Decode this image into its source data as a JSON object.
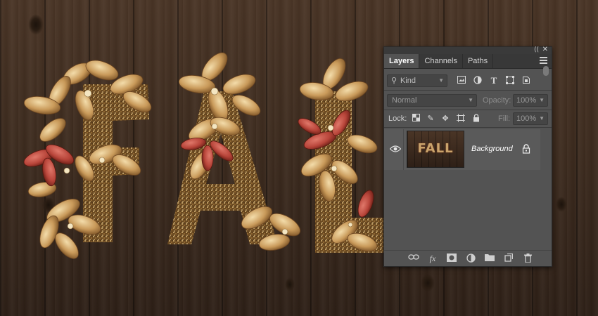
{
  "panel": {
    "tabs": [
      {
        "label": "Layers",
        "active": true
      },
      {
        "label": "Channels",
        "active": false
      },
      {
        "label": "Paths",
        "active": false
      }
    ],
    "collapse_icon": "double-chevron-icon",
    "close_icon": "close-icon",
    "menu_icon": "hamburger-menu-icon",
    "filter": {
      "kind_label": "Kind",
      "icons": [
        "search-icon",
        "pixel-layer-filter-icon",
        "adjustment-layer-filter-icon",
        "type-layer-filter-icon",
        "shape-layer-filter-icon",
        "smart-object-filter-icon"
      ]
    },
    "blend": {
      "mode": "Normal",
      "opacity_label": "Opacity:",
      "opacity_value": "100%"
    },
    "lock": {
      "label": "Lock:",
      "icons": [
        "lock-transparent-pixels-icon",
        "lock-image-pixels-icon",
        "lock-position-icon",
        "lock-artboard-icon",
        "lock-all-icon"
      ],
      "fill_label": "Fill:",
      "fill_value": "100%"
    },
    "layers": [
      {
        "name": "Background",
        "thumb_text": "FALL",
        "visible": true,
        "locked": true
      }
    ],
    "footer_icons": [
      "link-layers-icon",
      "layer-style-fx-icon",
      "add-mask-icon",
      "adjustment-layer-icon",
      "new-group-icon",
      "new-layer-icon",
      "delete-icon"
    ],
    "footer_fx": "fx"
  },
  "colors": {
    "panel_bg": "#535353",
    "panel_dark": "#383838",
    "wood": "#3e2c1f",
    "gold": "#c9a36b",
    "red_leaf": "#b8453a"
  }
}
